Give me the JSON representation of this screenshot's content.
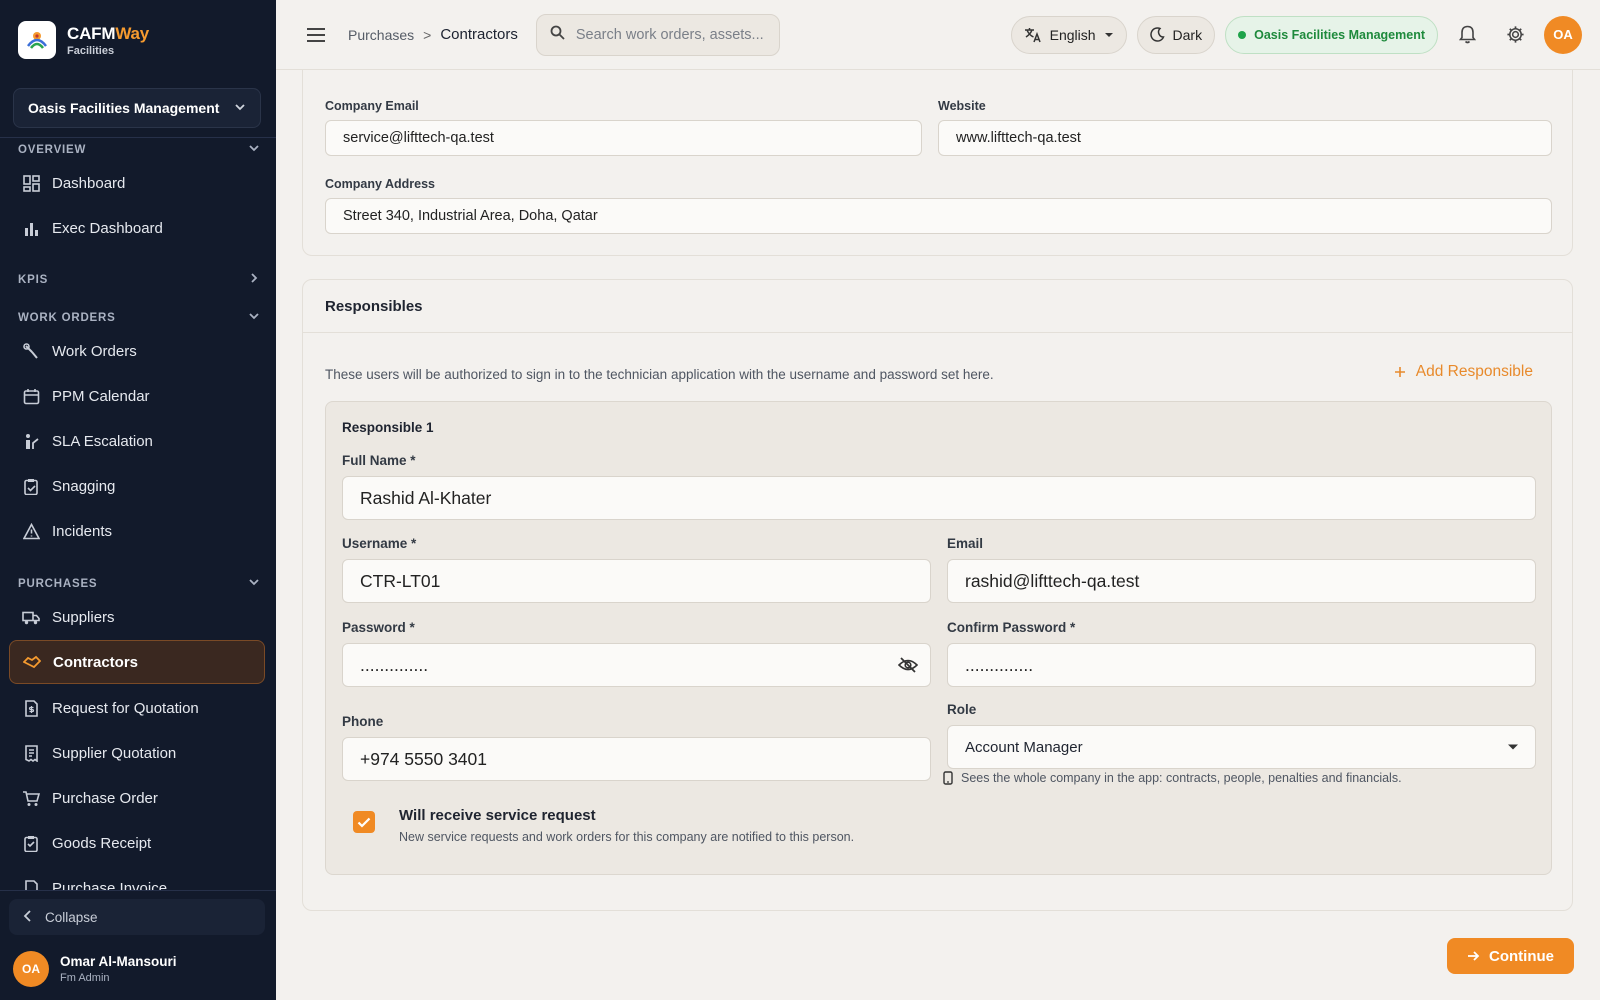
{
  "brand": {
    "name_main": "CAFM",
    "name_accent": "Way",
    "subtitle": "Facilities"
  },
  "sidebar": {
    "org_selector": "Oasis Facilities Management",
    "sections": {
      "overview": "OVERVIEW",
      "kpis": "KPIS",
      "work_orders": "WORK ORDERS",
      "purchases": "PURCHASES"
    },
    "items": {
      "dashboard": "Dashboard",
      "exec_dashboard": "Exec Dashboard",
      "work_orders": "Work Orders",
      "ppm_calendar": "PPM Calendar",
      "sla_escalation": "SLA Escalation",
      "snagging": "Snagging",
      "incidents": "Incidents",
      "suppliers": "Suppliers",
      "contractors": "Contractors",
      "rfq": "Request for Quotation",
      "supplier_quotation": "Supplier Quotation",
      "purchase_order": "Purchase Order",
      "goods_receipt": "Goods Receipt",
      "purchase_invoice": "Purchase Invoice"
    },
    "active_item": "Contractors",
    "collapse_label": "Collapse",
    "user": {
      "initials": "OA",
      "name": "Omar Al-Mansouri",
      "role": "Fm Admin"
    }
  },
  "topbar": {
    "breadcrumb": {
      "parent": "Purchases",
      "separator": ">",
      "current": "Contractors"
    },
    "search_placeholder": "Search work orders, assets...",
    "language": "English",
    "theme": "Dark",
    "org_badge": "Oasis Facilities Management",
    "avatar_initials": "OA"
  },
  "company": {
    "email_label": "Company Email",
    "email_value": "service@lifttech-qa.test",
    "website_label": "Website",
    "website_value": "www.lifttech-qa.test",
    "address_label": "Company Address",
    "address_value": "Street 340, Industrial Area, Doha, Qatar"
  },
  "responsibles": {
    "title": "Responsibles",
    "hint": "These users will be authorized to sign in to the technician application with the username and password set here.",
    "add_label": "Add Responsible",
    "item": {
      "title": "Responsible 1",
      "full_name_label": "Full Name *",
      "full_name_value": "Rashid Al-Khater",
      "username_label": "Username *",
      "username_value": "CTR-LT01",
      "email_label": "Email",
      "email_value": "rashid@lifttech-qa.test",
      "password_label": "Password *",
      "password_value": "..............",
      "confirm_password_label": "Confirm Password *",
      "confirm_password_value": "..............",
      "phone_label": "Phone",
      "phone_value": "+974 5550 3401",
      "role_label": "Role",
      "role_value": "Account Manager",
      "role_hint": "Sees the whole company in the app: contracts, people, penalties and financials.",
      "service_request_label": "Will receive service request",
      "service_request_sub": "New service requests and work orders for this company are notified to this person.",
      "service_request_checked": true
    }
  },
  "continue_label": "Continue",
  "colors": {
    "accent": "#f08a24",
    "sidebar_bg": "#121a2b",
    "org_badge_green": "#1e8a3c"
  }
}
